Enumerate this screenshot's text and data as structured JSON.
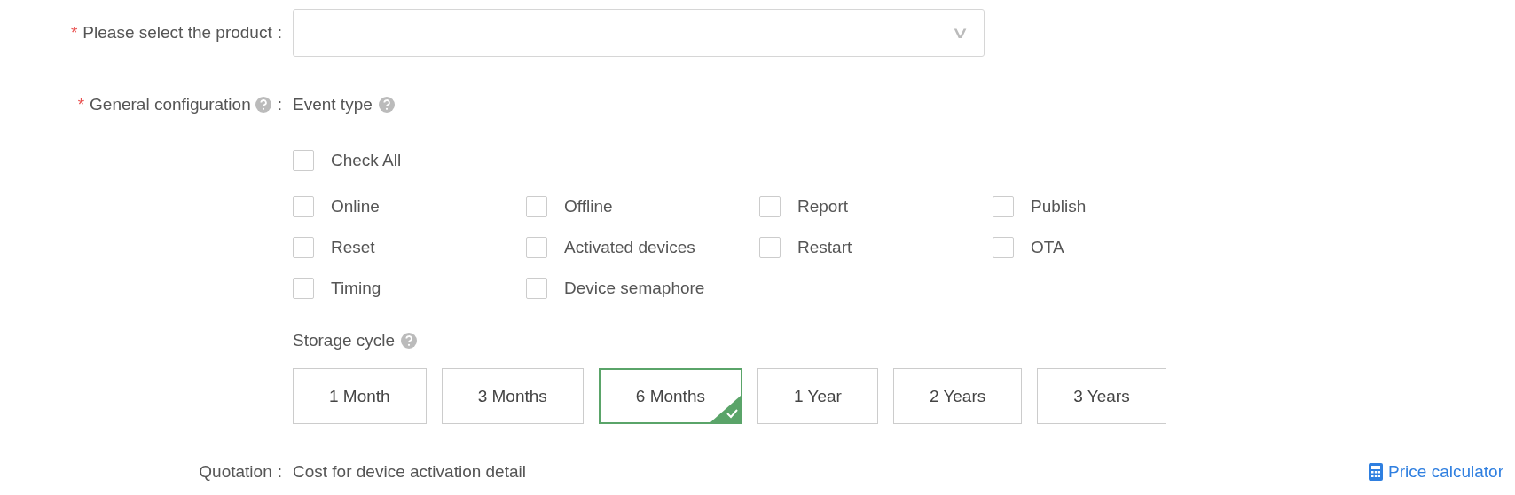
{
  "product": {
    "required_mark": "*",
    "label": "Please select the product",
    "separator": ":",
    "caret": "∨"
  },
  "general": {
    "required_mark": "*",
    "label": "General configuration",
    "separator": ":",
    "event_type": {
      "label": "Event type",
      "check_all": {
        "label": "Check All",
        "checked": false
      },
      "options": [
        {
          "label": "Online",
          "checked": false
        },
        {
          "label": "Offline",
          "checked": false
        },
        {
          "label": "Report",
          "checked": false
        },
        {
          "label": "Publish",
          "checked": false
        },
        {
          "label": "Reset",
          "checked": false
        },
        {
          "label": "Activated devices",
          "checked": false
        },
        {
          "label": "Restart",
          "checked": false
        },
        {
          "label": "OTA",
          "checked": false
        },
        {
          "label": "Timing",
          "checked": false
        },
        {
          "label": "Device semaphore",
          "checked": false
        }
      ]
    },
    "storage_cycle": {
      "label": "Storage cycle",
      "options": [
        {
          "label": "1 Month",
          "selected": false
        },
        {
          "label": "3 Months",
          "selected": false
        },
        {
          "label": "6 Months",
          "selected": true
        },
        {
          "label": "1 Year",
          "selected": false
        },
        {
          "label": "2 Years",
          "selected": false
        },
        {
          "label": "3 Years",
          "selected": false
        }
      ]
    }
  },
  "quotation": {
    "label": "Quotation",
    "separator": ":",
    "text": "Cost for device activation detail",
    "link": "Price calculator"
  }
}
